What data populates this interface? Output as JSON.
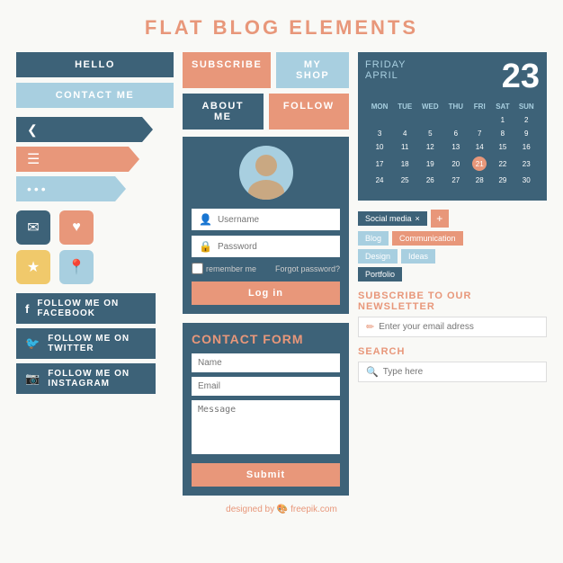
{
  "page": {
    "title": "FLAT BLOG ELEMENTS"
  },
  "top_buttons": {
    "hello": "HELLO",
    "subscribe": "SUBSCRIBE",
    "my_shop": "MY SHOP",
    "contact_me": "CONTACT ME",
    "about_me": "ABOUT ME",
    "follow": "FOLLOW"
  },
  "ribbons": {
    "share": "❮",
    "menu": "≡",
    "dots": "…"
  },
  "social": {
    "facebook": "FOLLOW ME ON FACEBOOK",
    "twitter": "FOLLOW ME ON TWITTER",
    "instagram": "FOLLOW ME ON INSTAGRAM"
  },
  "profile": {
    "username_placeholder": "Username",
    "password_placeholder": "Password",
    "remember_me": "remember me",
    "forgot_password": "Forgot password?",
    "login_btn": "Log in"
  },
  "contact_form": {
    "title": "CONTACT FORM",
    "name_placeholder": "Name",
    "email_placeholder": "Email",
    "message_placeholder": "Message",
    "submit_btn": "Submit"
  },
  "calendar": {
    "day": "FRIDAY",
    "month": "APRIL",
    "date": "23",
    "days_header": [
      "MON",
      "TUE",
      "WED",
      "THU",
      "FRI",
      "SAT",
      "SUN"
    ],
    "weeks": [
      [
        "",
        "",
        "",
        "",
        "",
        "1",
        "2"
      ],
      [
        "3",
        "4",
        "5",
        "6",
        "7",
        "8",
        "9"
      ],
      [
        "10",
        "11",
        "12",
        "13",
        "14",
        "15",
        "16"
      ],
      [
        "17",
        "18",
        "19",
        "20",
        "21",
        "22",
        "23"
      ],
      [
        "24",
        "25",
        "26",
        "27",
        "28",
        "29",
        "30"
      ],
      [
        "",
        "",
        "",
        "",
        "",
        "",
        ""
      ]
    ],
    "today": "21"
  },
  "tags": {
    "active_tag": "Social media",
    "items": [
      "Blog",
      "Communication",
      "Design",
      "Ideas",
      "Portfolio"
    ]
  },
  "newsletter": {
    "title": "SUBSCRIBE TO OUR NEWSLETTER",
    "placeholder": "Enter your email adress"
  },
  "search": {
    "title": "SEARCH",
    "placeholder": "Type here"
  },
  "footer": {
    "text": "designed by",
    "brand": "freepik.com"
  }
}
